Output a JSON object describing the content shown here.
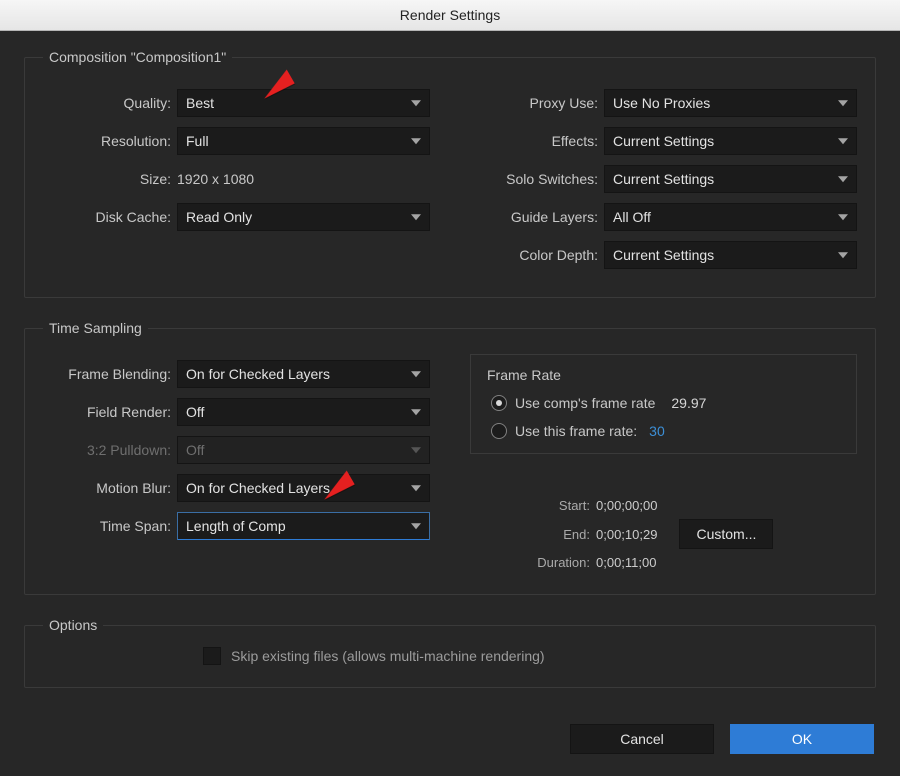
{
  "window": {
    "title": "Render Settings"
  },
  "comp": {
    "legend": "Composition \"Composition1\"",
    "labels": {
      "quality": "Quality:",
      "resolution": "Resolution:",
      "size": "Size:",
      "disk_cache": "Disk Cache:",
      "proxy_use": "Proxy Use:",
      "effects": "Effects:",
      "solo_switches": "Solo Switches:",
      "guide_layers": "Guide Layers:",
      "color_depth": "Color Depth:"
    },
    "values": {
      "quality": "Best",
      "resolution": "Full",
      "size": "1920 x 1080",
      "disk_cache": "Read Only",
      "proxy_use": "Use No Proxies",
      "effects": "Current Settings",
      "solo_switches": "Current Settings",
      "guide_layers": "All Off",
      "color_depth": "Current Settings"
    }
  },
  "time_sampling": {
    "legend": "Time Sampling",
    "labels": {
      "frame_blending": "Frame Blending:",
      "field_render": "Field Render:",
      "pulldown": "3:2 Pulldown:",
      "motion_blur": "Motion Blur:",
      "time_span": "Time Span:"
    },
    "values": {
      "frame_blending": "On for Checked Layers",
      "field_render": "Off",
      "pulldown": "Off",
      "motion_blur": "On for Checked Layers",
      "time_span": "Length of Comp"
    },
    "frame_rate": {
      "title": "Frame Rate",
      "use_comp_label": "Use comp's frame rate",
      "use_comp_value": "29.97",
      "use_this_label": "Use this frame rate:",
      "use_this_value": "30"
    },
    "time_info": {
      "start_label": "Start:",
      "start_value": "0;00;00;00",
      "end_label": "End:",
      "end_value": "0;00;10;29",
      "duration_label": "Duration:",
      "duration_value": "0;00;11;00",
      "custom_label": "Custom..."
    }
  },
  "options": {
    "legend": "Options",
    "skip_label": "Skip existing files (allows multi-machine rendering)"
  },
  "footer": {
    "cancel": "Cancel",
    "ok": "OK"
  }
}
